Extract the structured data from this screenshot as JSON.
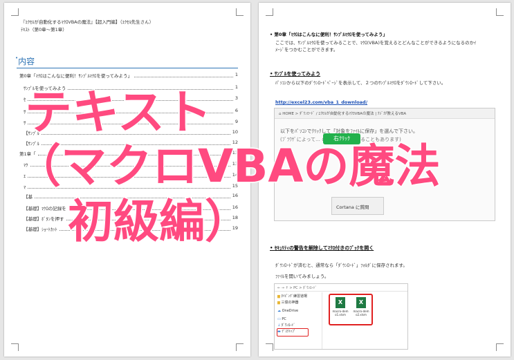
{
  "left_page": {
    "header_line1": "『ｴｸｾﾙが自動化するﾏｸﾛVBAの魔法』【超入門編】（ｴｸｾﾙ先生さん）",
    "header_line2": "ﾃｷｽﾄ（第0章～第1章）",
    "toc_title": "内容",
    "toc_items": [
      {
        "text": "第0章「ﾏｸﾛはこんなに便利！ｻﾝﾌﾟﾙﾏｸﾛを使ってみよう」",
        "page": "1"
      },
      {
        "text": "ｻﾝﾌﾟﾙを使ってみよう",
        "page": "1"
      },
      {
        "text": "ｾ",
        "page": "3"
      },
      {
        "text": "ｻ",
        "page": "6"
      },
      {
        "text": "ｻ",
        "page": "9"
      },
      {
        "text": "【ｻﾝﾌﾟﾙ",
        "page": "10"
      },
      {
        "text": "【ｻﾝﾌﾟﾙ",
        "page": "12"
      },
      {
        "text": "第1章「",
        "page": "13"
      },
      {
        "text": "ﾏｸ",
        "page": "13"
      },
      {
        "text": "ｴ",
        "page": "14"
      },
      {
        "text": "ﾏ",
        "page": "15"
      },
      {
        "text": "【基",
        "page": "16"
      },
      {
        "text": "【基礎】ﾏｸﾛの記録を",
        "page": "16"
      },
      {
        "text": "【基礎】ﾎﾞﾀﾝを押す",
        "page": "18"
      },
      {
        "text": "【基礎】ｼｮｰﾄｶｯﾄ",
        "page": "19"
      }
    ]
  },
  "right_page": {
    "chapter_heading": "第0章「ﾏｸﾛはこんなに便利！ｻﾝﾌﾟﾙﾏｸﾛを使ってみよう」",
    "intro_line1": "ここでは、ｻﾝﾌﾟﾙﾏｸﾛを使ってみることで、ﾏｸﾛ(VBA)を覚えるとどんなことができるようになるのかｲ",
    "intro_line2": "ﾒｰｼﾞをつかむことができます。",
    "section1_heading": "ｻﾝﾌﾟﾙを使ってみよう",
    "section1_line": "ﾊﾟｿｺﾝから以下のﾀﾞｳﾝﾛｰﾄﾞﾍﾟｰｼﾞを表示して、２つのｻﾝﾌﾟﾙﾏｸﾛをﾀﾞｳﾝﾛｰﾄﾞして下さい。",
    "download_link": "http://excel23.com/vba_1_download/",
    "screenshot1": {
      "breadcrumb": "HOME > ﾀﾞｳﾝﾛｰﾄﾞ / ｴｸｾﾙが自動化するﾏｸﾛVBAの魔法 | ｸｼﾞが教えるVBA",
      "line1": "以下をﾊﾟｿｺﾝでｸﾘｯｸして「対象をﾌｧｲﾙに保存」を選んで下さい。",
      "line2": "(ﾌﾞﾗｳｻﾞによって... のように表示されることもあります)",
      "right_click_label": "右ｸﾘｯｸ",
      "menu_item": "Cortana に質問"
    },
    "section2_heading": "ｾｷｭﾘﾃｨの警告を解除してﾏｸﾛ付きのﾌﾞｯｸを開く",
    "section2_line1": "ﾀﾞｳﾝﾛｰﾄﾞが済むと、通常なら「ﾀﾞｳﾝﾛｰﾄﾞ」ﾌｫﾙﾀﾞに保存されます。",
    "section2_line2": "ﾌｧｲﾙを開いてみましょう。",
    "screenshot2": {
      "path": "> PC > ﾀﾞｳﾝﾛｰﾄﾞ",
      "tree": [
        "ﾀｲﾋﾟﾝｸﾞ練習道場",
        "三億の神器",
        "OneDrive",
        "PC",
        "ﾀﾞｳﾝﾛｰﾄﾞ",
        "ﾃﾞｽｸﾄｯﾌﾟ"
      ],
      "files": [
        "macro-demo1.xlsm",
        "macro-demo2.xlsm"
      ]
    }
  },
  "overlay": {
    "line1": "テキスト",
    "line2": "（マクロVBAの魔法",
    "line3": "初級編）"
  },
  "colors": {
    "overlay_text": "#ff4a80",
    "toc_title": "#2e74b5",
    "link": "#1a4fb5",
    "green_button": "#22b14c",
    "highlight_red": "#e02020"
  }
}
